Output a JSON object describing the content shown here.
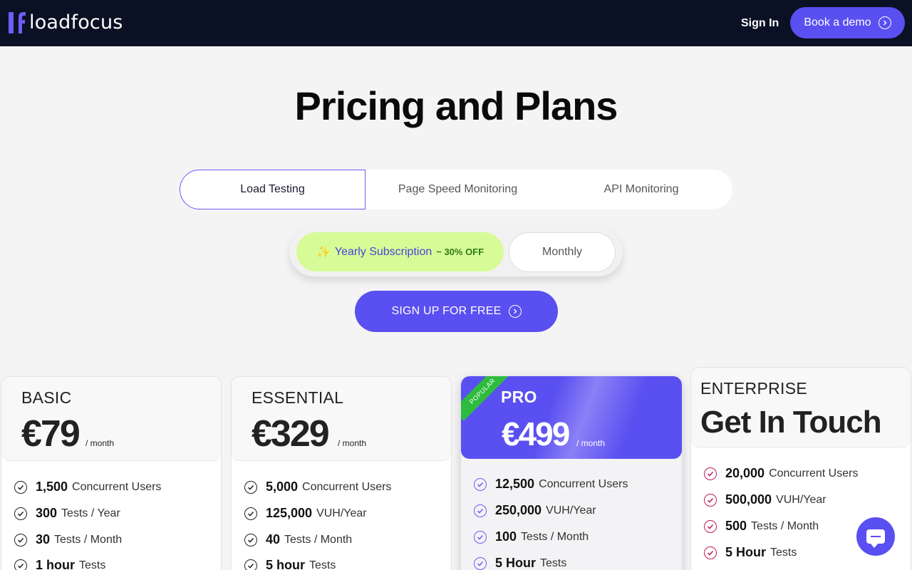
{
  "header": {
    "logo_text": "loadfocus",
    "signin_label": "Sign In",
    "demo_label": "Book a demo"
  },
  "title": "Pricing and Plans",
  "product_tabs": [
    {
      "label": "Load Testing",
      "active": true
    },
    {
      "label": "Page Speed Monitoring",
      "active": false
    },
    {
      "label": "API Monitoring",
      "active": false
    }
  ],
  "billing": {
    "yearly_icon": "✨",
    "yearly_label": "Yearly Subscription",
    "yearly_discount": "~ 30% OFF",
    "monthly_label": "Monthly",
    "selected": "yearly"
  },
  "signup_label": "SIGN UP FOR FREE",
  "plans": [
    {
      "name": "BASIC",
      "price": "€79",
      "per": "/ month",
      "features": [
        {
          "num": "1,500",
          "text": "Concurrent Users"
        },
        {
          "num": "300",
          "text": "Tests / Year"
        },
        {
          "num": "30",
          "text": "Tests / Month"
        },
        {
          "num": "1 hour",
          "text": "Tests"
        }
      ]
    },
    {
      "name": "ESSENTIAL",
      "price": "€329",
      "per": "/ month",
      "features": [
        {
          "num": "5,000",
          "text": "Concurrent Users"
        },
        {
          "num": "125,000",
          "text": "VUH/Year"
        },
        {
          "num": "40",
          "text": "Tests / Month"
        },
        {
          "num": "5 hour",
          "text": "Tests"
        }
      ]
    },
    {
      "name": "PRO",
      "price": "€499",
      "per": "/ month",
      "badge": "POPULAR",
      "features": [
        {
          "num": "12,500",
          "text": "Concurrent Users"
        },
        {
          "num": "250,000",
          "text": "VUH/Year"
        },
        {
          "num": "100",
          "text": "Tests / Month"
        },
        {
          "num": "5 Hour",
          "text": "Tests"
        }
      ]
    },
    {
      "name": "ENTERPRISE",
      "price": "Get In Touch",
      "features": [
        {
          "num": "20,000",
          "text": "Concurrent Users"
        },
        {
          "num": "500,000",
          "text": "VUH/Year"
        },
        {
          "num": "500",
          "text": "Tests / Month"
        },
        {
          "num": "5 Hour",
          "text": "Tests"
        }
      ]
    }
  ],
  "colors": {
    "header_bg": "#0b1124",
    "accent": "#5a4ff0",
    "yearly_bg": "#d7fc97",
    "popular_ribbon": "#2ebc3f",
    "enterprise_check": "#c2185b"
  }
}
